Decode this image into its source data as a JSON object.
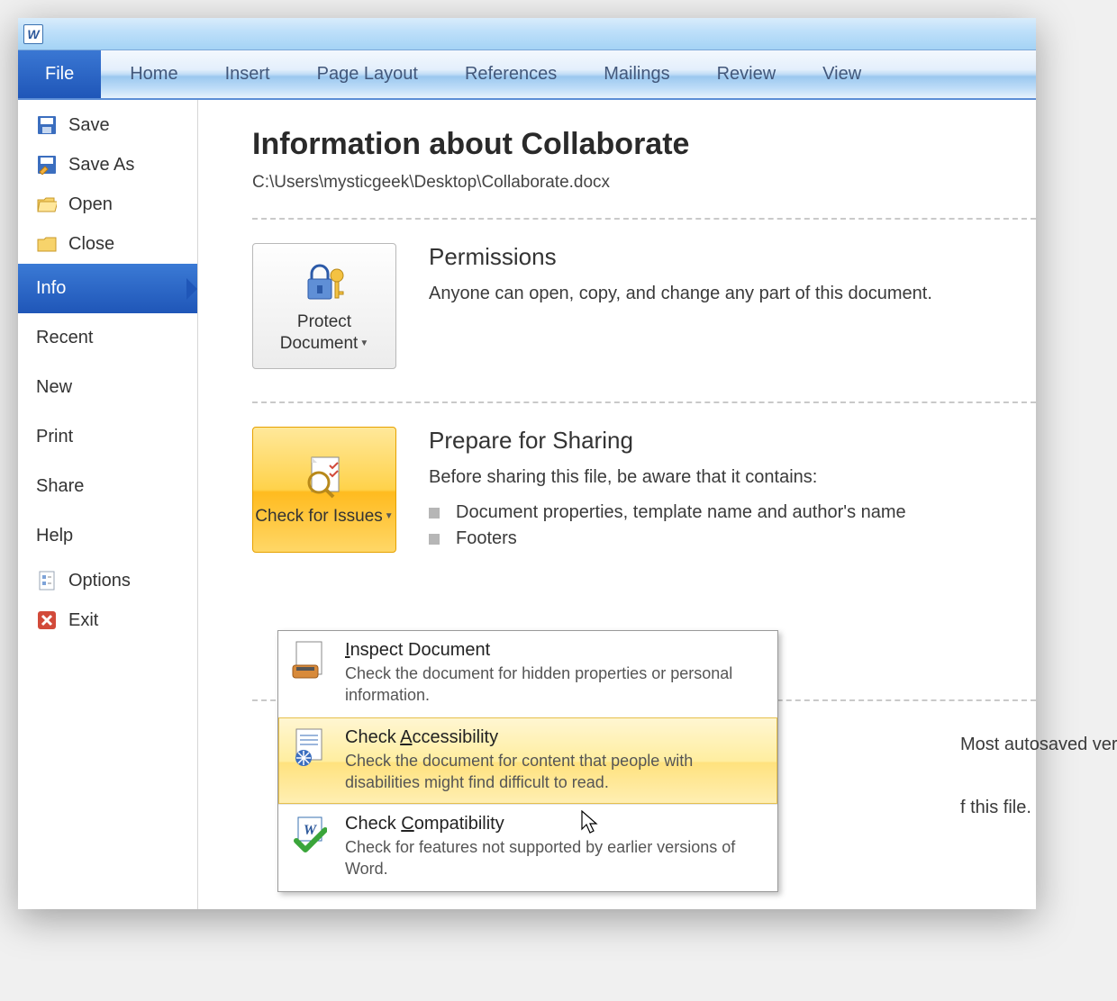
{
  "titlebar": {
    "app_letter": "W"
  },
  "ribbon": {
    "tabs": [
      "File",
      "Home",
      "Insert",
      "Page Layout",
      "References",
      "Mailings",
      "Review",
      "View"
    ]
  },
  "sidebar": {
    "items": [
      {
        "label": "Save",
        "icon": "save"
      },
      {
        "label": "Save As",
        "icon": "saveas"
      },
      {
        "label": "Open",
        "icon": "open"
      },
      {
        "label": "Close",
        "icon": "close"
      },
      {
        "label": "Info",
        "icon": null,
        "active": true,
        "big": true
      },
      {
        "label": "Recent",
        "icon": null,
        "big": true
      },
      {
        "label": "New",
        "icon": null,
        "big": true
      },
      {
        "label": "Print",
        "icon": null,
        "big": true
      },
      {
        "label": "Share",
        "icon": null,
        "big": true
      },
      {
        "label": "Help",
        "icon": null,
        "big": true
      },
      {
        "label": "Options",
        "icon": "options"
      },
      {
        "label": "Exit",
        "icon": "exit"
      }
    ]
  },
  "main": {
    "title": "Information about Collaborate",
    "path": "C:\\Users\\mysticgeek\\Desktop\\Collaborate.docx",
    "sections": {
      "permissions": {
        "button": "Protect Document",
        "heading": "Permissions",
        "body": "Anyone can open, copy, and change any part of this document."
      },
      "prepare": {
        "button": "Check for Issues",
        "heading": "Prepare for Sharing",
        "lead": "Before sharing this file, be aware that it contains:",
        "items": [
          "Document properties, template name and author's name",
          "Footers"
        ]
      }
    },
    "peek1": "Most autosaved versions are",
    "peek2": "f this file."
  },
  "menu": {
    "items": [
      {
        "title_pre": "",
        "title_u": "I",
        "title_post": "nspect Document",
        "desc": "Check the document for hidden properties or personal information."
      },
      {
        "title_pre": "Check ",
        "title_u": "A",
        "title_post": "ccessibility",
        "desc": "Check the document for content that people with disabilities might find difficult to read.",
        "hover": true
      },
      {
        "title_pre": "Check ",
        "title_u": "C",
        "title_post": "ompatibility",
        "desc": "Check for features not supported by earlier versions of Word."
      }
    ]
  }
}
